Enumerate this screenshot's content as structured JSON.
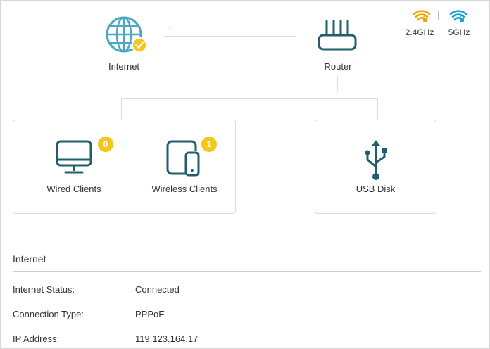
{
  "topology": {
    "internet_label": "Internet",
    "router_label": "Router"
  },
  "wifi": {
    "band_24_label": "2.4GHz",
    "band_5_label": "5GHz",
    "band_24_color": "#f0a500",
    "band_5_color": "#1aa0d8"
  },
  "clients": {
    "wired_label": "Wired Clients",
    "wired_count": "0",
    "wireless_label": "Wireless Clients",
    "wireless_count": "1",
    "usb_label": "USB Disk"
  },
  "internet_section": {
    "title": "Internet",
    "rows": [
      {
        "key": "Internet Status:",
        "value": "Connected"
      },
      {
        "key": "Connection Type:",
        "value": "PPPoE"
      },
      {
        "key": "IP Address:",
        "value": "119.123.164.17"
      }
    ]
  },
  "colors": {
    "icon_teal": "#1f5f6b",
    "globe_blue": "#4aa8c4",
    "badge_yellow": "#f5c518"
  },
  "icons": [
    "globe-icon",
    "check-icon",
    "router-icon",
    "wifi-icon",
    "monitor-icon",
    "tablet-phone-icon",
    "usb-icon"
  ]
}
